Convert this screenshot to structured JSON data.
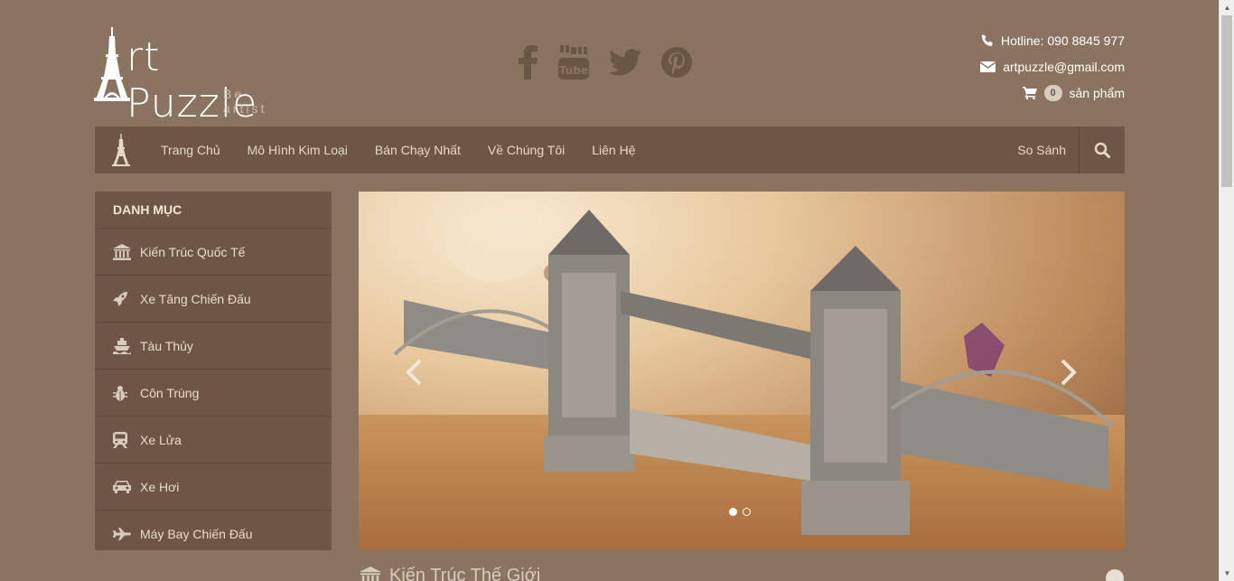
{
  "logo": {
    "word": "rt Puzzle",
    "tagline": "Be artist"
  },
  "social": [
    {
      "icon": "facebook-icon"
    },
    {
      "icon": "youtube-icon"
    },
    {
      "icon": "twitter-icon"
    },
    {
      "icon": "pinterest-icon"
    }
  ],
  "contact": {
    "hotline": "Hotline: 090 8845 977",
    "email": "artpuzzle@gmail.com",
    "cart_count": "0",
    "cart_label": "sản phẩm"
  },
  "nav": {
    "items": [
      "Trang Chủ",
      "Mô Hình Kim Loại",
      "Bán Chạy Nhất",
      "Về Chúng Tôi",
      "Liên Hệ"
    ],
    "compare": "So Sánh"
  },
  "sidebar": {
    "title": "DANH MỤC",
    "categories": [
      {
        "label": "Kiến Trúc Quốc Tế",
        "icon": "bank-icon"
      },
      {
        "label": "Xe Tăng Chiến Đấu",
        "icon": "rocket-icon"
      },
      {
        "label": "Tàu Thủy",
        "icon": "ship-icon"
      },
      {
        "label": "Côn Trùng",
        "icon": "bug-icon"
      },
      {
        "label": "Xe Lửa",
        "icon": "train-icon"
      },
      {
        "label": "Xe Hơi",
        "icon": "car-icon"
      },
      {
        "label": "Máy Bay Chiến Đấu",
        "icon": "plane-icon"
      }
    ]
  },
  "slider": {
    "slide_count": 2,
    "active_index": 0
  },
  "section": {
    "title": "Kiến Trúc Thế Giới"
  },
  "colors": {
    "background": "#8a7460",
    "panel": "#6e5646",
    "accent_text": "#e6d8c6"
  }
}
